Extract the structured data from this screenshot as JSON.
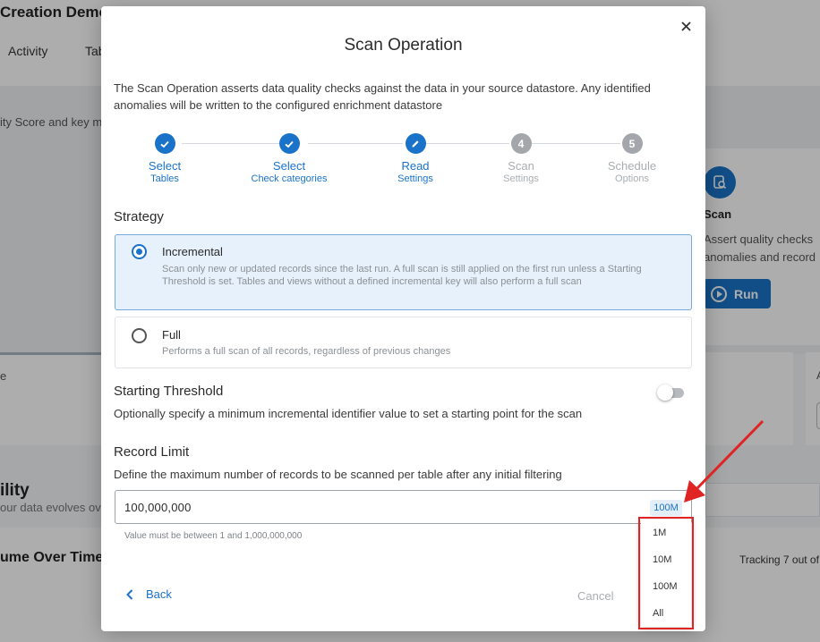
{
  "background": {
    "title": "Creation Demo",
    "tabs": [
      "Activity",
      "Tab"
    ],
    "left_text": "ity Score and key m",
    "scan_card": {
      "title": "Scan",
      "description_lines": [
        "Assert quality checks",
        "anomalies and record"
      ],
      "run_label": "Run"
    },
    "left_card_text": "e",
    "right_card_text": "A",
    "section_title": "ility",
    "section_sub": "our data evolves ov",
    "volume_title": "ume Over Time",
    "tracking_text": "Tracking 7 out of"
  },
  "modal": {
    "title": "Scan Operation",
    "intro": "The Scan Operation asserts data quality checks against the data in your source datastore. Any identified anomalies will be written to the configured enrichment datastore",
    "steps": [
      {
        "line1": "Select",
        "line2": "Tables",
        "badge": "",
        "status": "done"
      },
      {
        "line1": "Select",
        "line2": "Check categories",
        "badge": "",
        "status": "done"
      },
      {
        "line1": "Read",
        "line2": "Settings",
        "badge": "",
        "status": "current"
      },
      {
        "line1": "Scan",
        "line2": "Settings",
        "badge": "4",
        "status": "pending"
      },
      {
        "line1": "Schedule",
        "line2": "Options",
        "badge": "5",
        "status": "pending"
      }
    ],
    "strategy": {
      "label": "Strategy",
      "options": [
        {
          "title": "Incremental",
          "description": "Scan only new or updated records since the last run. A full scan is still applied on the first run unless a Starting Threshold is set. Tables and views without a defined incremental key will also perform a full scan",
          "selected": true
        },
        {
          "title": "Full",
          "description": "Performs a full scan of all records, regardless of previous changes",
          "selected": false
        }
      ]
    },
    "starting_threshold": {
      "label": "Starting Threshold",
      "description": "Optionally specify a minimum incremental identifier value to set a starting point for the scan",
      "enabled": false
    },
    "record_limit": {
      "label": "Record Limit",
      "description": "Define the maximum number of records to be scanned per table after any initial filtering",
      "value": "100,000,000",
      "unit": "100M",
      "helper": "Value must be between 1 and 1,000,000,000",
      "menu_options": [
        "1M",
        "10M",
        "100M",
        "All"
      ]
    },
    "footer": {
      "back_label": "Back",
      "cancel_label": "Cancel"
    }
  },
  "colors": {
    "accent": "#1a73c8",
    "annotation": "#e02424"
  }
}
